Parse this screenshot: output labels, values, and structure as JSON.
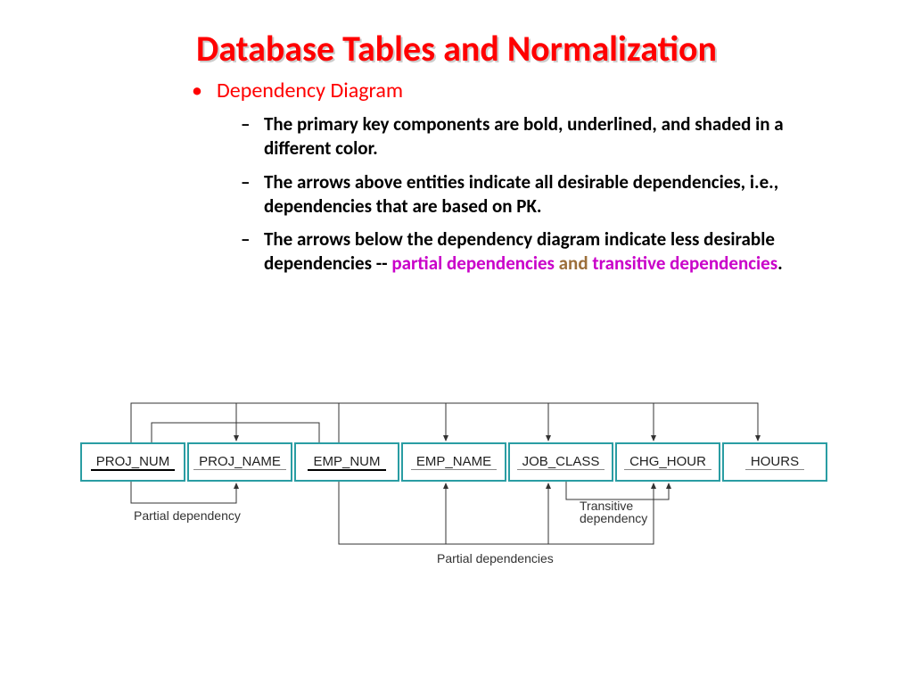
{
  "title": "Database Tables and Normalization",
  "bullet1": "Dependency Diagram",
  "sub1": "The primary key components are bold, underlined, and shaded in a different color.",
  "sub2": "The arrows above entities indicate all desirable dependencies, i.e., dependencies that are based on PK.",
  "sub3_a": "The arrows below the dependency diagram indicate less desirable dependencies -- ",
  "sub3_b": "partial dependencies",
  "sub3_c": " and ",
  "sub3_d": "transitive dependencies",
  "sub3_e": ".",
  "fields": {
    "f0": "PROJ_NUM",
    "f1": "PROJ_NAME",
    "f2": "EMP_NUM",
    "f3": "EMP_NAME",
    "f4": "JOB_CLASS",
    "f5": "CHG_HOUR",
    "f6": "HOURS"
  },
  "labels": {
    "partial1": "Partial dependency",
    "transitive": "Transitive dependency",
    "partial2": "Partial dependencies"
  }
}
